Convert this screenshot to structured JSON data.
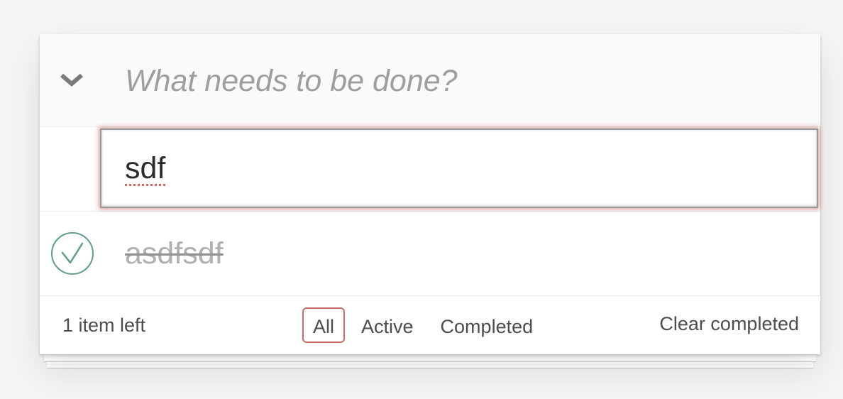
{
  "header": {
    "new_todo_placeholder": "What needs to be done?",
    "toggle_all_icon": "chevron-down-icon"
  },
  "editing": {
    "value": "sdf"
  },
  "todos": [
    {
      "title": "asdfsdf",
      "completed": true
    }
  ],
  "footer": {
    "count_label": "1 item left",
    "filters": [
      {
        "label": "All",
        "selected": true
      },
      {
        "label": "Active",
        "selected": false
      },
      {
        "label": "Completed",
        "selected": false
      }
    ],
    "clear_label": "Clear completed"
  },
  "colors": {
    "selected_filter_border": "#c76b6b",
    "check_green": "#5dc2af",
    "edit_glow": "#af2f2f"
  }
}
